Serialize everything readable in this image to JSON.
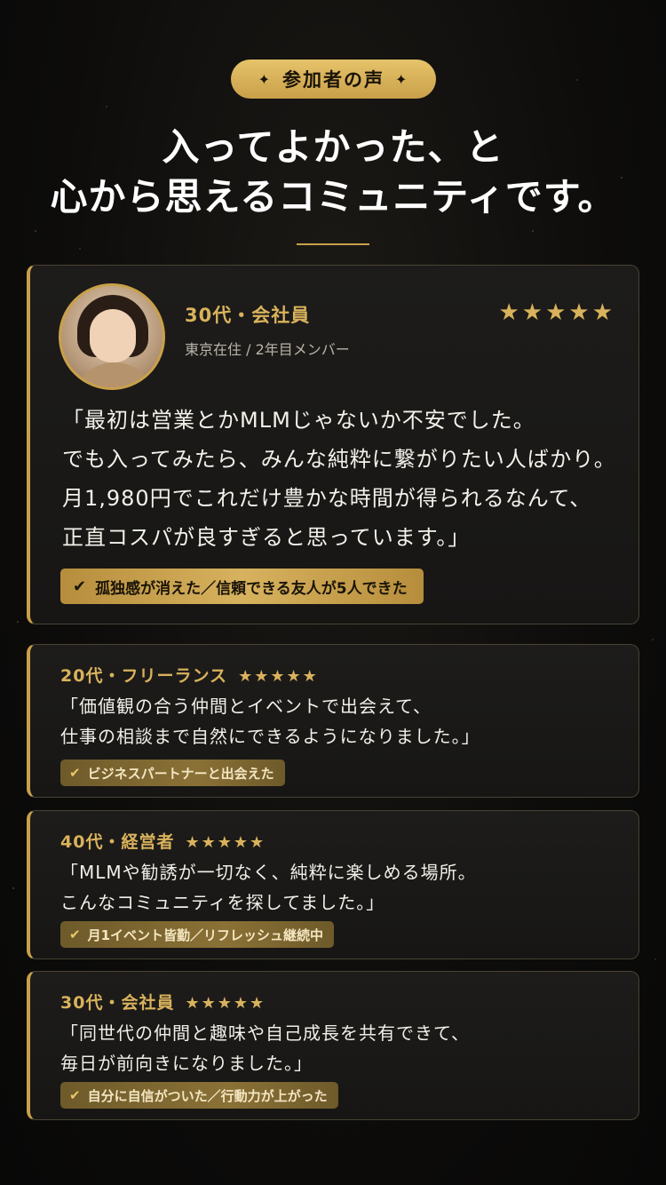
{
  "badge": {
    "label": "参加者の声",
    "spark": "✦"
  },
  "headline": {
    "line1": "入ってよかった、と",
    "line2": "心から思えるコミュニティです。"
  },
  "colors": {
    "gold": "#d9b25c",
    "background": "#0d0c0b",
    "card": "#1b1a18"
  },
  "featured": {
    "title": "30代・会社員",
    "subtitle": "東京在住 / 2年目メンバー",
    "stars": "★★★★★",
    "rating": 5,
    "quote": "「最初は営業とかMLMじゃないか不安でした。\nでも入ってみたら、みんな純粋に繋がりたい人ばかり。\n月1,980円でこれだけ豊かな時間が得られるなんて、\n正直コスパが良すぎると思っています。」",
    "tag": "孤独感が消えた／信頼できる友人が5人できた",
    "avatar_icon": "woman-portrait-icon"
  },
  "reviews": [
    {
      "title": "20代・フリーランス",
      "stars": "★★★★★",
      "rating": 5,
      "quote": "「価値観の合う仲間とイベントで出会えて、\n 仕事の相談まで自然にできるようになりました。」",
      "tag": "ビジネスパートナーと出会えた"
    },
    {
      "title": "40代・経営者",
      "stars": "★★★★★",
      "rating": 5,
      "quote": "「MLMや勧誘が一切なく、純粋に楽しめる場所。\n こんなコミュニティを探してました。」",
      "tag": "月1イベント皆勤／リフレッシュ継続中"
    },
    {
      "title": "30代・会社員",
      "stars": "★★★★★",
      "rating": 5,
      "quote": "「同世代の仲間と趣味や自己成長を共有できて、\n 毎日が前向きになりました。」",
      "tag": "自分に自信がついた／行動力が上がった"
    }
  ],
  "check_glyph": "✔"
}
